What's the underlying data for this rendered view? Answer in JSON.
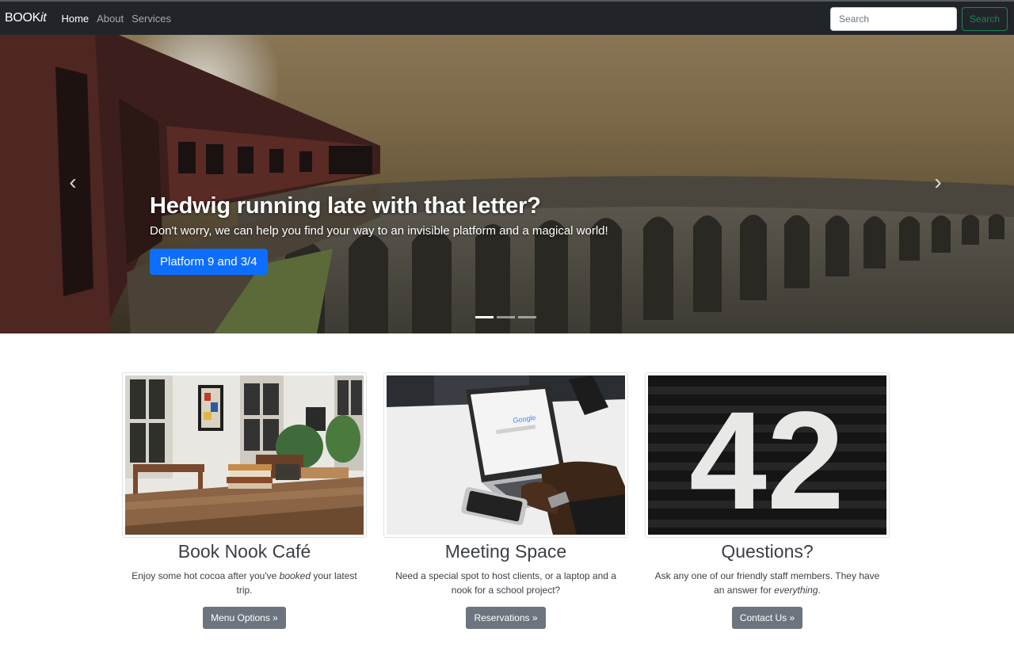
{
  "navbar": {
    "brand_main": "BOOK",
    "brand_italic": "it",
    "links": [
      {
        "label": "Home",
        "active": true
      },
      {
        "label": "About",
        "active": false
      },
      {
        "label": "Services",
        "active": false
      }
    ],
    "search_placeholder": "Search",
    "search_button": "Search"
  },
  "hero": {
    "title": "Hedwig running late with that letter?",
    "subtitle": "Don't worry, we can help you find your way to an invisible platform and a magical world!",
    "cta": "Platform 9 and 3/4",
    "prev_icon": "chevron-left-icon",
    "next_icon": "chevron-right-icon",
    "slides": 3,
    "active_slide": 1
  },
  "cards": [
    {
      "title": "Book Nook Café",
      "text_before": "Enjoy some hot cocoa after you've ",
      "text_em": "booked",
      "text_after": " your latest trip.",
      "button": "Menu Options »"
    },
    {
      "title": "Meeting Space",
      "text_before": "Need a special spot to host clients, or a laptop and a nook for a school project?",
      "text_em": "",
      "text_after": "",
      "button": "Reservations »"
    },
    {
      "title": "Questions?",
      "text_before": "Ask any one of our friendly staff members. They have an answer for ",
      "text_em": "everything",
      "text_after": ".",
      "button": "Contact Us »"
    }
  ],
  "images": {
    "number_sign": "42"
  },
  "colors": {
    "navbar_bg": "#212529",
    "primary": "#0d6efd",
    "success": "#198754",
    "secondary": "#6c757d"
  }
}
